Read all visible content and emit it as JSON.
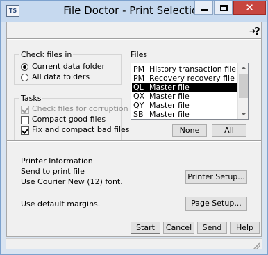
{
  "window": {
    "title": "File Doctor - Print Selection",
    "app_icon_text": "TS",
    "minimize_icon": "minimize-icon",
    "maximize_icon": "maximize-icon",
    "close_icon": "close-icon",
    "close_glyph": "✕",
    "help_icon": "context-help-icon",
    "help_glyph": "?",
    "help_arrow_glyph": "➔"
  },
  "check_files": {
    "label": "Check files in",
    "options": [
      {
        "label": "Current data folder",
        "selected": true
      },
      {
        "label": "All data folders",
        "selected": false
      }
    ]
  },
  "tasks": {
    "label": "Tasks",
    "items": [
      {
        "label": "Check files for corruption",
        "checked": true,
        "disabled": true
      },
      {
        "label": "Compact good files",
        "checked": false,
        "disabled": false
      },
      {
        "label": "Fix and compact bad files",
        "checked": true,
        "disabled": false
      }
    ]
  },
  "files": {
    "label": "Files",
    "items": [
      {
        "code": "PM",
        "name": "History transaction file",
        "selected": false
      },
      {
        "code": "PM",
        "name": "Recovery recovery file",
        "selected": false
      },
      {
        "code": "QL",
        "name": "Master file",
        "selected": true
      },
      {
        "code": "QX",
        "name": "Master file",
        "selected": false
      },
      {
        "code": "QY",
        "name": "Master file",
        "selected": false
      },
      {
        "code": "SB",
        "name": "Master file",
        "selected": false
      }
    ],
    "none_button": "None",
    "all_button": "All"
  },
  "printer": {
    "label": "Printer Information",
    "line1": "Send to print file",
    "line2": "Use Courier New (12) font.",
    "line3": "Use default margins.",
    "printer_setup_button": "Printer Setup...",
    "page_setup_button": "Page Setup..."
  },
  "actions": {
    "start": "Start",
    "cancel": "Cancel",
    "send": "Send",
    "help": "Help"
  },
  "colors": {
    "titlebar": "#c6d9ef",
    "close": "#c7463f",
    "selection": "#000000",
    "dialog_bg": "#f0f0f0"
  }
}
